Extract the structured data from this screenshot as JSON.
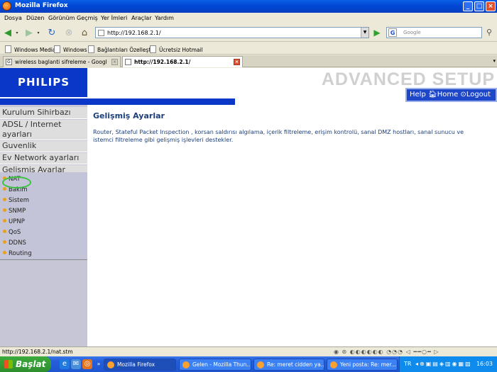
{
  "window": {
    "title": "Mozilla Firefox"
  },
  "menu": [
    "Dosya",
    "Düzen",
    "Görünüm",
    "Geçmiş",
    "Yer İmleri",
    "Araçlar",
    "Yardım"
  ],
  "address": {
    "url": "http://192.168.2.1/"
  },
  "search": {
    "placeholder": "Google"
  },
  "bookmarks": [
    "Windows Media",
    "Windows",
    "Bağlantıları Özelleştir",
    "Ücretsiz Hotmail"
  ],
  "tabs": [
    {
      "label": "wireless baglanti sifreleme - Google'da...",
      "active": false
    },
    {
      "label": "http://192.168.2.1/",
      "active": true
    }
  ],
  "router": {
    "logo": "PHILIPS",
    "header": "ADVANCED SETUP",
    "toplinks": {
      "help": "Help",
      "home": "Home",
      "logout": "Logout"
    },
    "sidebar": [
      "Kurulum Sihirbazı",
      "ADSL / Internet ayarları",
      "Guvenlik",
      "Ev Network ayarları",
      "Gelişmiş Ayarlar"
    ],
    "submenu": [
      "NAT",
      "Bakım",
      "Sistem",
      "SNMP",
      "UPNP",
      "QoS",
      "DDNS",
      "Routing"
    ],
    "title": "Gelişmiş Ayarlar",
    "description": "Router, Stateful Packet Inspection , korsan saldırısı algılama, içerik filtreleme, erişim kontrolü, sanal DMZ hostları, sanal sunucu ve istemci filtreleme gibi gelişmiş işlevleri destekler."
  },
  "status": {
    "text": "http://192.168.2.1/nat.stm"
  },
  "taskbar": {
    "start": "Başlat",
    "buttons": [
      "Mozilla Firefox",
      "Gelen - Mozilla Thun...",
      "Re: meret cidden ya...",
      "Yeni posta: Re: mer..."
    ],
    "lang": "TR",
    "clock": "16:03"
  }
}
